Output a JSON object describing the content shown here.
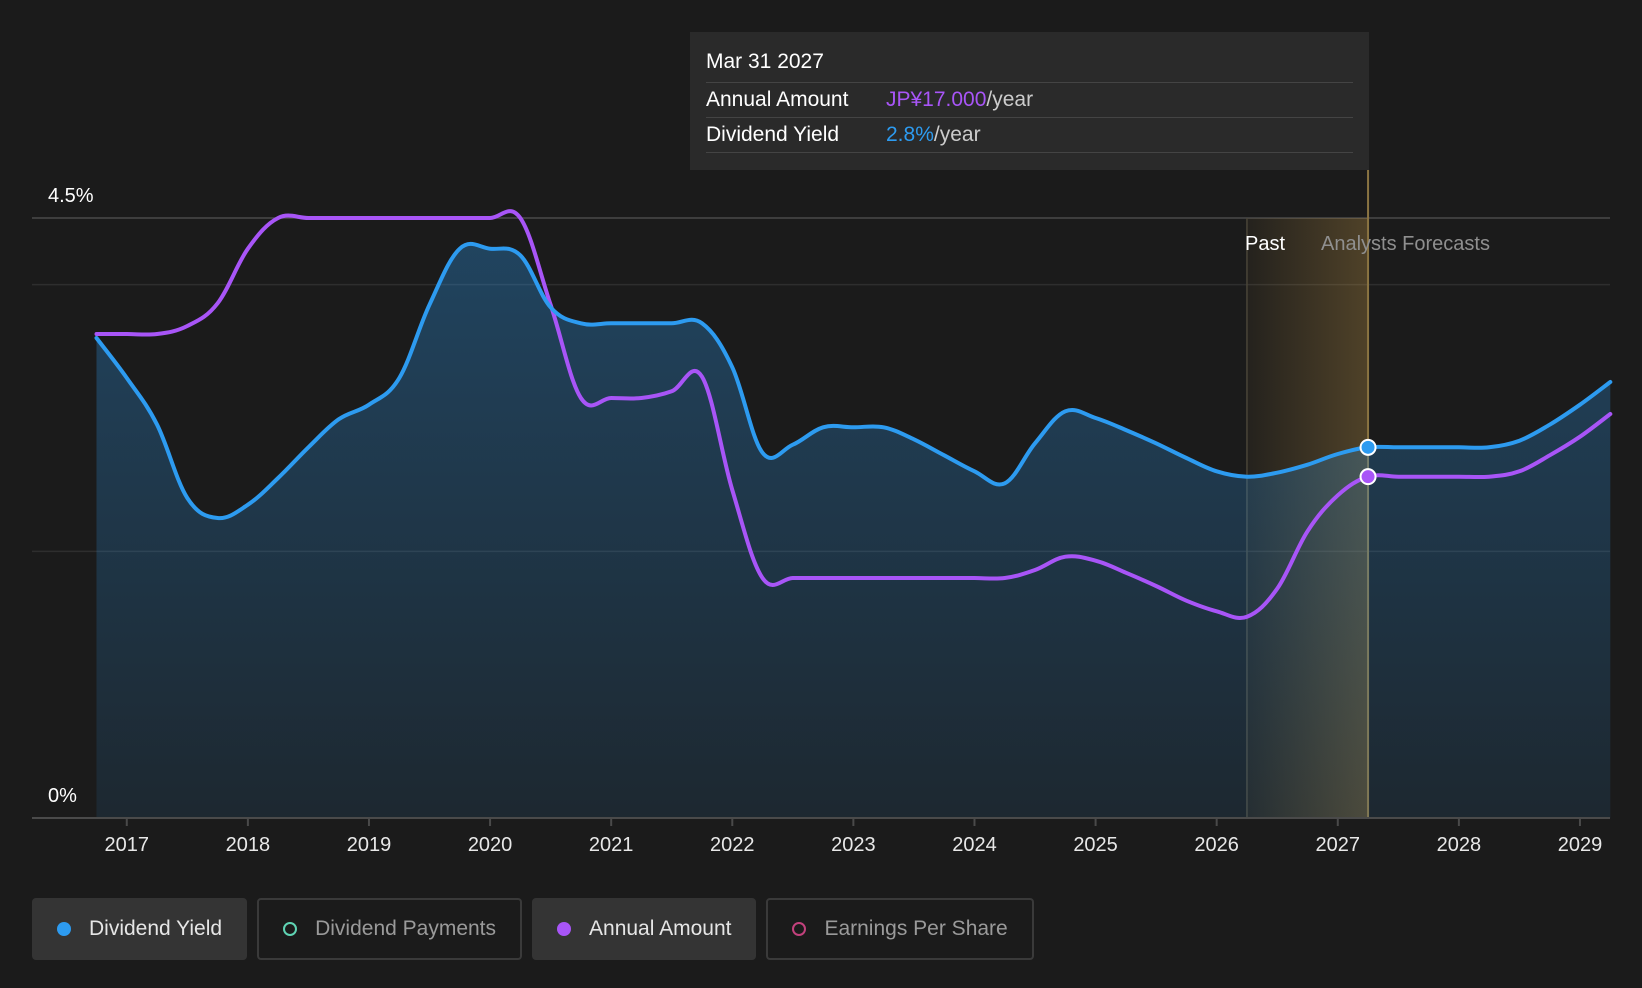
{
  "tooltip": {
    "date": "Mar 31 2027",
    "rows": [
      {
        "label": "Annual Amount",
        "value": "JP¥17.000",
        "unit": "/year"
      },
      {
        "label": "Dividend Yield",
        "value": "2.8%",
        "unit": "/year"
      }
    ]
  },
  "legend": [
    {
      "label": "Dividend Yield",
      "color": "#2d9bf0",
      "active": true
    },
    {
      "label": "Dividend Payments",
      "color": "#5fd3b3",
      "active": false
    },
    {
      "label": "Annual Amount",
      "color": "#a855f7",
      "active": true
    },
    {
      "label": "Earnings Per Share",
      "color": "#c2417c",
      "active": false
    }
  ],
  "colors": {
    "background": "#1b1b1b",
    "dividend_yield": "#2d9bf0",
    "annual_amount": "#a855f7",
    "forecast_band": "#d6a54a"
  },
  "chart_data": {
    "type": "line",
    "title": "",
    "xlabel": "",
    "ylabel": "",
    "y_tick_labels": [
      "4.5%",
      "0%"
    ],
    "ylim": [
      0,
      4.5
    ],
    "xlim": [
      2016.5,
      2029.25
    ],
    "x_ticks": [
      2017,
      2018,
      2019,
      2020,
      2021,
      2022,
      2023,
      2024,
      2025,
      2026,
      2027,
      2028,
      2029
    ],
    "x_tick_labels": [
      "2017",
      "2018",
      "2019",
      "2020",
      "2021",
      "2022",
      "2023",
      "2024",
      "2025",
      "2026",
      "2027",
      "2028",
      "2029"
    ],
    "grid": true,
    "past_label": "Past",
    "forecast_label": "Analysts Forecasts",
    "forecast_region": {
      "start": 2026.25,
      "end": 2027.25
    },
    "highlight_x": 2027.25,
    "series": [
      {
        "name": "Dividend Yield",
        "area": true,
        "points": [
          [
            2016.75,
            3.6
          ],
          [
            2017.0,
            3.3
          ],
          [
            2017.25,
            2.95
          ],
          [
            2017.5,
            2.4
          ],
          [
            2017.75,
            2.25
          ],
          [
            2018.0,
            2.35
          ],
          [
            2018.25,
            2.55
          ],
          [
            2018.5,
            2.78
          ],
          [
            2018.75,
            2.99
          ],
          [
            2019.0,
            3.1
          ],
          [
            2019.25,
            3.3
          ],
          [
            2019.5,
            3.85
          ],
          [
            2019.75,
            4.27
          ],
          [
            2020.0,
            4.27
          ],
          [
            2020.25,
            4.22
          ],
          [
            2020.5,
            3.83
          ],
          [
            2020.75,
            3.71
          ],
          [
            2021.0,
            3.71
          ],
          [
            2021.25,
            3.71
          ],
          [
            2021.5,
            3.71
          ],
          [
            2021.75,
            3.71
          ],
          [
            2022.0,
            3.38
          ],
          [
            2022.25,
            2.74
          ],
          [
            2022.5,
            2.8
          ],
          [
            2022.75,
            2.93
          ],
          [
            2023.0,
            2.93
          ],
          [
            2023.25,
            2.93
          ],
          [
            2023.5,
            2.84
          ],
          [
            2023.75,
            2.72
          ],
          [
            2024.0,
            2.6
          ],
          [
            2024.25,
            2.51
          ],
          [
            2024.5,
            2.81
          ],
          [
            2024.75,
            3.05
          ],
          [
            2025.0,
            3.0
          ],
          [
            2025.25,
            2.91
          ],
          [
            2025.5,
            2.81
          ],
          [
            2025.75,
            2.7
          ],
          [
            2026.0,
            2.6
          ],
          [
            2026.25,
            2.56
          ],
          [
            2026.5,
            2.59
          ],
          [
            2026.75,
            2.65
          ],
          [
            2027.0,
            2.73
          ],
          [
            2027.25,
            2.78
          ],
          [
            2027.5,
            2.78
          ],
          [
            2027.75,
            2.78
          ],
          [
            2028.0,
            2.78
          ],
          [
            2028.25,
            2.78
          ],
          [
            2028.5,
            2.83
          ],
          [
            2028.75,
            2.95
          ],
          [
            2029.0,
            3.1
          ],
          [
            2029.25,
            3.27
          ]
        ]
      },
      {
        "name": "Annual Amount",
        "area": false,
        "points": [
          [
            2016.75,
            3.63
          ],
          [
            2017.0,
            3.63
          ],
          [
            2017.25,
            3.63
          ],
          [
            2017.5,
            3.69
          ],
          [
            2017.75,
            3.86
          ],
          [
            2018.0,
            4.27
          ],
          [
            2018.25,
            4.5
          ],
          [
            2018.5,
            4.5
          ],
          [
            2018.75,
            4.5
          ],
          [
            2019.0,
            4.5
          ],
          [
            2019.25,
            4.5
          ],
          [
            2019.5,
            4.5
          ],
          [
            2019.75,
            4.5
          ],
          [
            2020.0,
            4.5
          ],
          [
            2020.25,
            4.5
          ],
          [
            2020.5,
            3.85
          ],
          [
            2020.75,
            3.15
          ],
          [
            2021.0,
            3.15
          ],
          [
            2021.25,
            3.15
          ],
          [
            2021.5,
            3.2
          ],
          [
            2021.75,
            3.31
          ],
          [
            2022.0,
            2.46
          ],
          [
            2022.25,
            1.8
          ],
          [
            2022.5,
            1.8
          ],
          [
            2022.75,
            1.8
          ],
          [
            2023.0,
            1.8
          ],
          [
            2023.25,
            1.8
          ],
          [
            2023.5,
            1.8
          ],
          [
            2023.75,
            1.8
          ],
          [
            2024.0,
            1.8
          ],
          [
            2024.25,
            1.8
          ],
          [
            2024.5,
            1.86
          ],
          [
            2024.75,
            1.96
          ],
          [
            2025.0,
            1.93
          ],
          [
            2025.25,
            1.84
          ],
          [
            2025.5,
            1.74
          ],
          [
            2025.75,
            1.63
          ],
          [
            2026.0,
            1.55
          ],
          [
            2026.25,
            1.51
          ],
          [
            2026.5,
            1.72
          ],
          [
            2026.75,
            2.15
          ],
          [
            2027.0,
            2.42
          ],
          [
            2027.25,
            2.56
          ],
          [
            2027.5,
            2.56
          ],
          [
            2027.75,
            2.56
          ],
          [
            2028.0,
            2.56
          ],
          [
            2028.25,
            2.56
          ],
          [
            2028.5,
            2.6
          ],
          [
            2028.75,
            2.72
          ],
          [
            2029.0,
            2.86
          ],
          [
            2029.25,
            3.03
          ]
        ]
      }
    ]
  }
}
